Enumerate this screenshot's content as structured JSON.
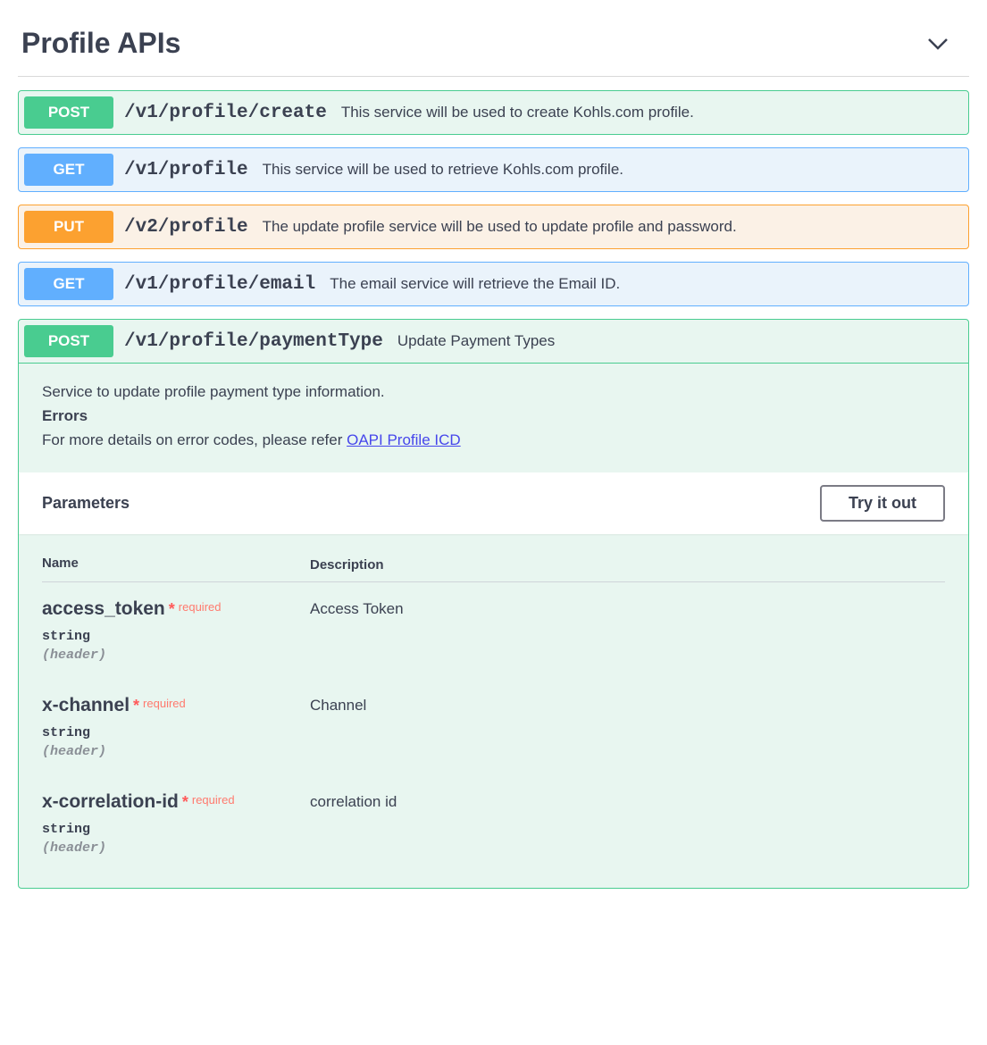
{
  "section": {
    "title": "Profile APIs"
  },
  "operations": [
    {
      "method": "POST",
      "methodClass": "post",
      "path": "/v1/profile/create",
      "summary": "This service will be used to create Kohls.com profile."
    },
    {
      "method": "GET",
      "methodClass": "get",
      "path": "/v1/profile",
      "summary": "This service will be used to retrieve Kohls.com profile."
    },
    {
      "method": "PUT",
      "methodClass": "put",
      "path": "/v2/profile",
      "summary": "The update profile service will be used to update profile and password."
    },
    {
      "method": "GET",
      "methodClass": "get",
      "path": "/v1/profile/email",
      "summary": "The email service will retrieve the Email ID."
    }
  ],
  "expanded": {
    "method": "POST",
    "methodClass": "post",
    "path": "/v1/profile/paymentType",
    "summary": "Update Payment Types",
    "desc_line1": "Service to update profile payment type information.",
    "errors_heading": "Errors",
    "desc_line2_prefix": "For more details on error codes, please refer ",
    "desc_link_text": "OAPI Profile ICD",
    "parameters_label": "Parameters",
    "try_label": "Try it out",
    "table_header_name": "Name",
    "table_header_desc": "Description",
    "required_label": "required",
    "params": [
      {
        "name": "access_token",
        "required": true,
        "type": "string",
        "in": "(header)",
        "desc": "Access Token"
      },
      {
        "name": "x-channel",
        "required": true,
        "type": "string",
        "in": "(header)",
        "desc": "Channel"
      },
      {
        "name": "x-correlation-id",
        "required": true,
        "type": "string",
        "in": "(header)",
        "desc": "correlation id"
      }
    ]
  }
}
